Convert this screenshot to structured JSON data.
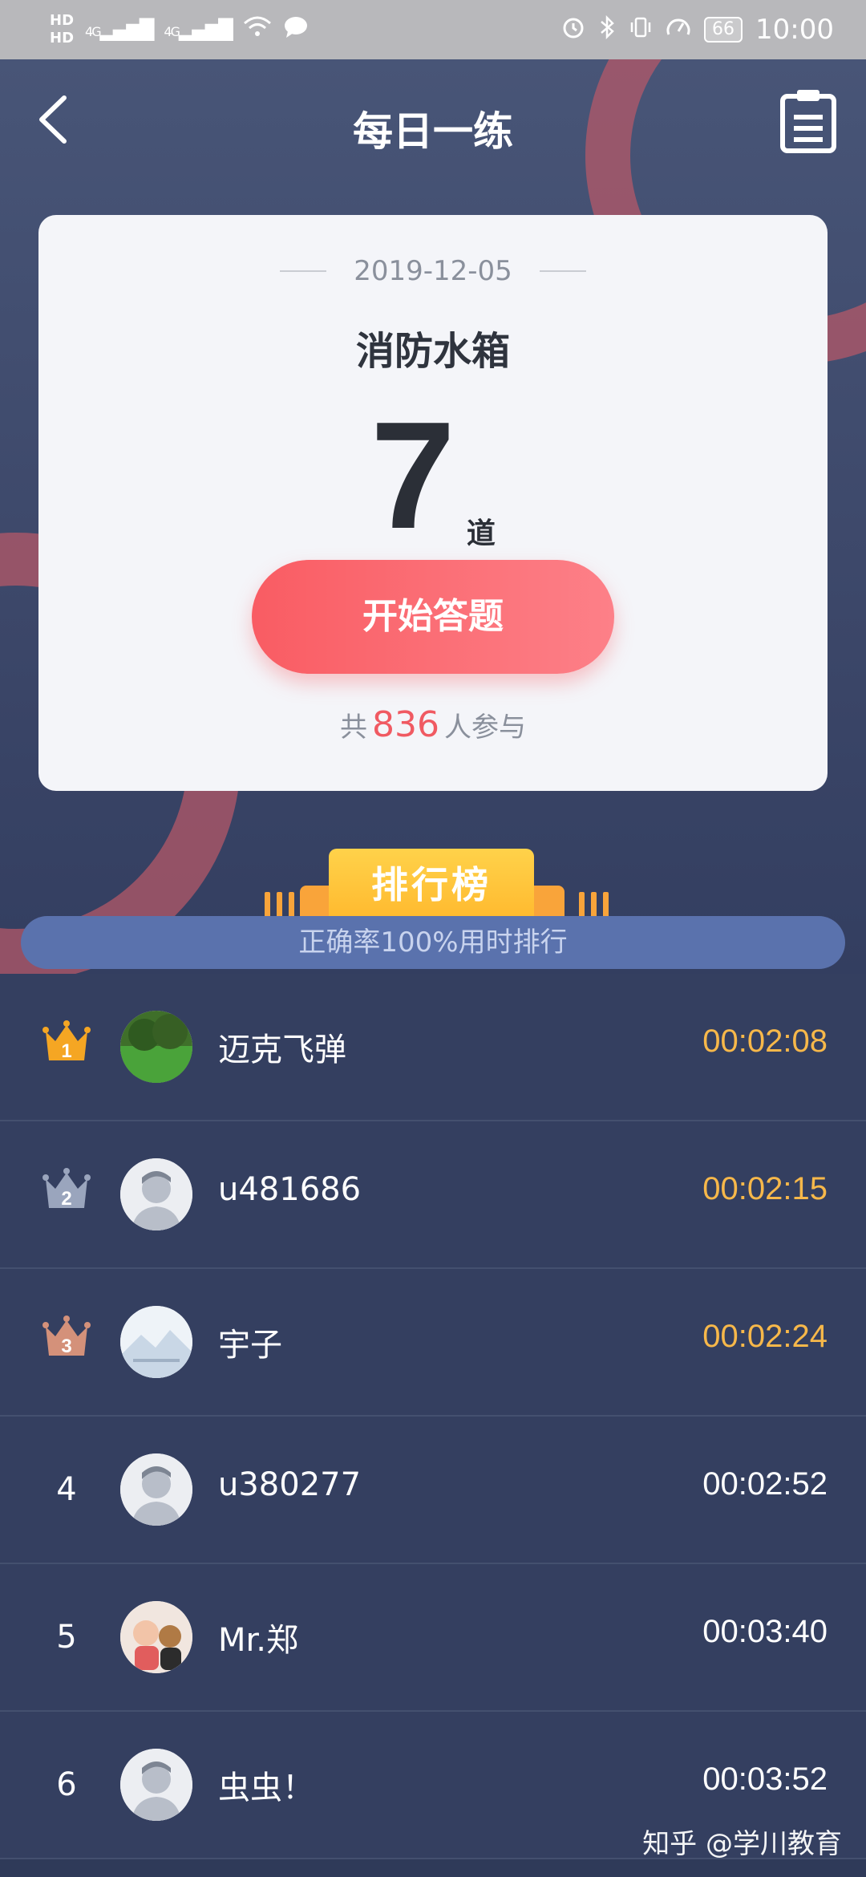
{
  "status_bar": {
    "hd1": "HD",
    "hd2": "HD",
    "net1": "4G",
    "net2": "4G",
    "battery": "66",
    "time": "10:00",
    "icons": [
      "hd-icon",
      "signal-icon",
      "wifi-icon",
      "chat-icon",
      "alarm-icon",
      "bluetooth-icon",
      "vibrate-icon",
      "speed-icon",
      "battery-icon"
    ]
  },
  "header": {
    "title": "每日一练",
    "back_icon": "back-icon",
    "calendar_icon": "clipboard-icon"
  },
  "card": {
    "date": "2019-12-05",
    "topic": "消防水箱",
    "count": "7",
    "count_unit": "道",
    "start_label": "开始答题",
    "participants_prefix": "共",
    "participants_count": "836",
    "participants_suffix": "人参与"
  },
  "leaderboard": {
    "title": "排行榜",
    "subtitle": "正确率100%用时排行",
    "rows": [
      {
        "rank": "1",
        "name": "迈克飞弹",
        "time": "00:02:08",
        "avatar": "grass-photo"
      },
      {
        "rank": "2",
        "name": "u481686",
        "time": "00:02:15",
        "avatar": "default-avatar"
      },
      {
        "rank": "3",
        "name": "宇子",
        "time": "00:02:24",
        "avatar": "mountain-photo"
      },
      {
        "rank": "4",
        "name": "u380277",
        "time": "00:02:52",
        "avatar": "default-avatar"
      },
      {
        "rank": "5",
        "name": "Mr.郑",
        "time": "00:03:40",
        "avatar": "baby-photo"
      },
      {
        "rank": "6",
        "name": "虫虫！",
        "time": "00:03:52",
        "avatar": "default-avatar"
      }
    ]
  },
  "watermark": "知乎 @学川教育",
  "colors": {
    "accent": "#f95c63",
    "gold": "#f7b84a",
    "bg": "#343f60"
  }
}
